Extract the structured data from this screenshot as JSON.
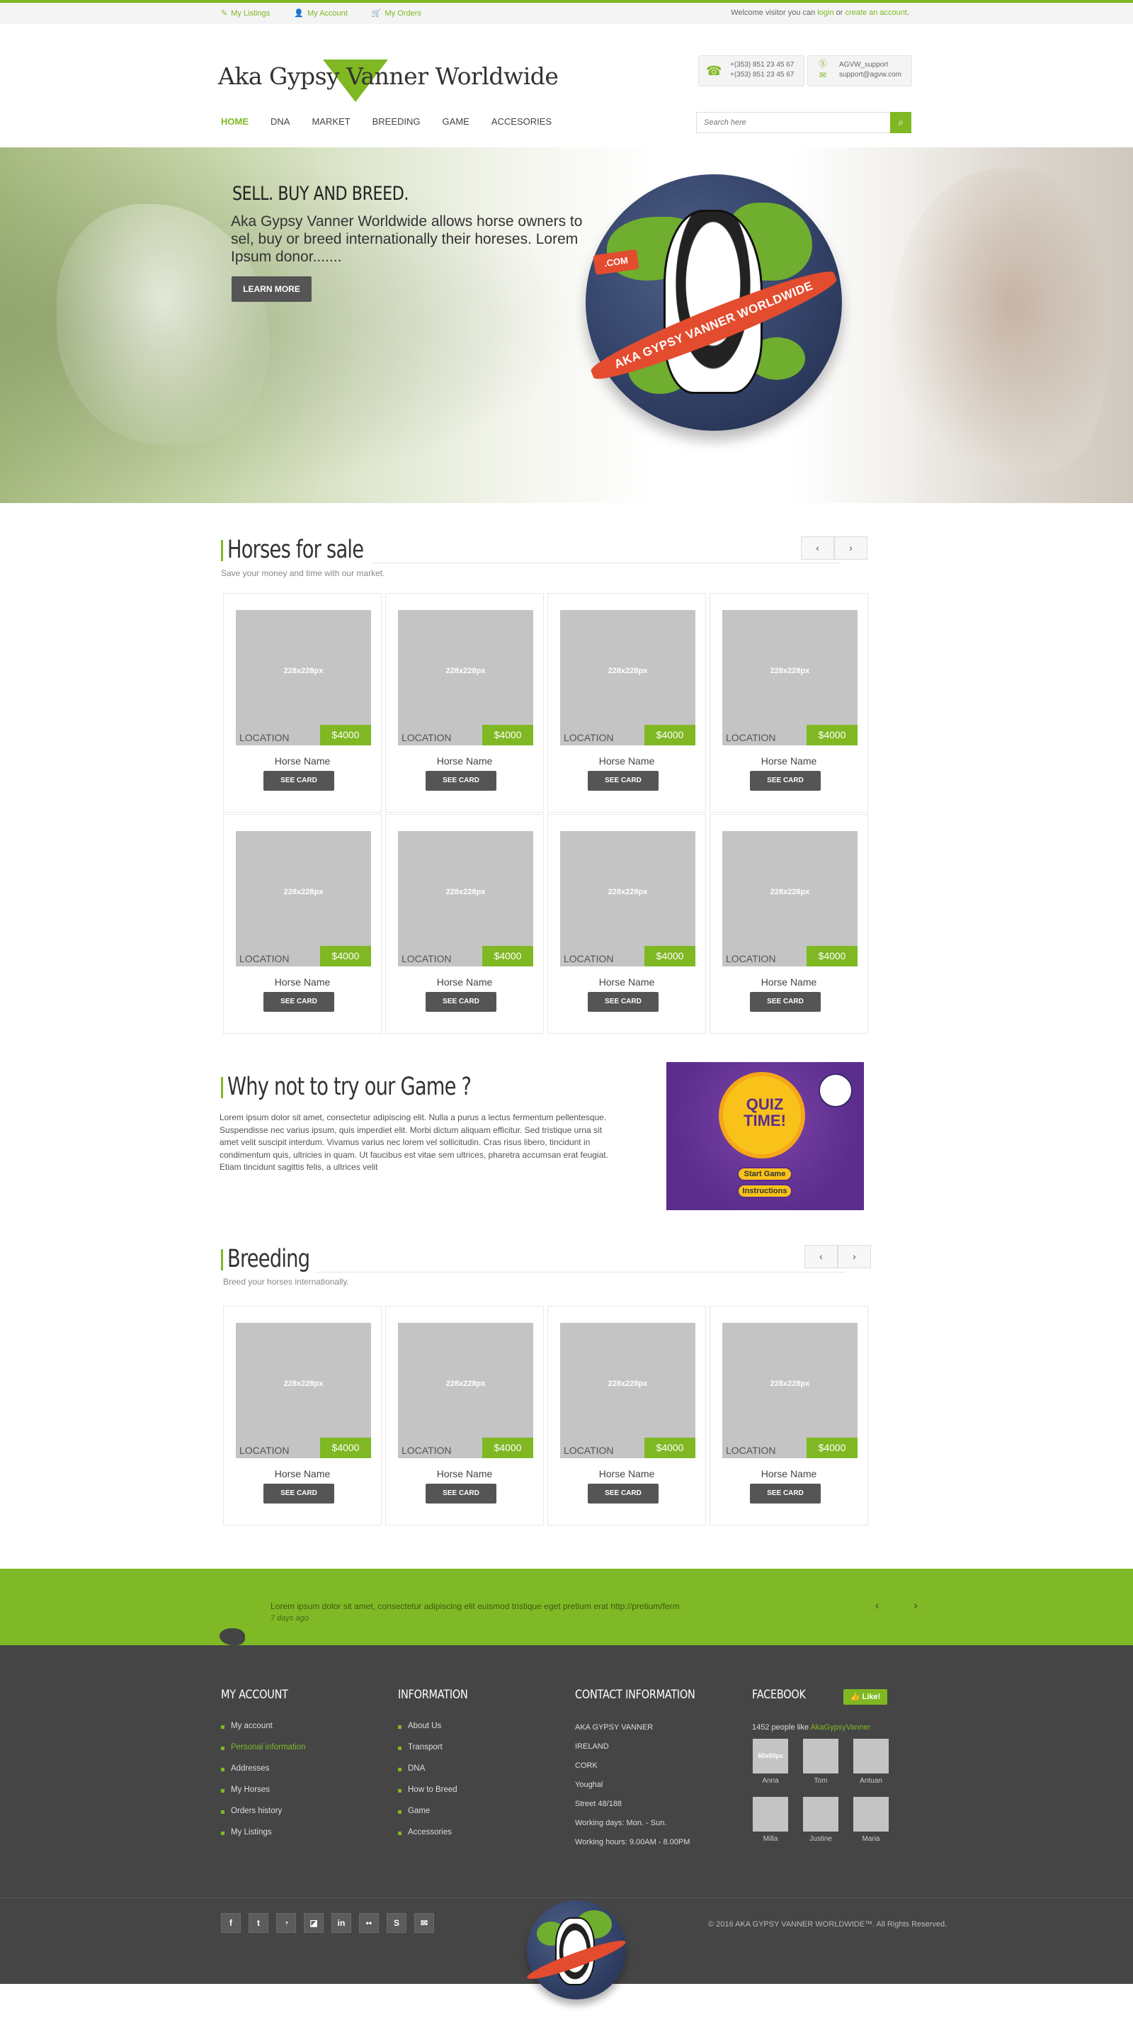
{
  "topbar": {
    "links": [
      {
        "icon": "edit-icon",
        "label": "My Listings"
      },
      {
        "icon": "user-icon",
        "label": "My Account"
      },
      {
        "icon": "cart-icon",
        "label": "My Orders"
      }
    ],
    "welcome_prefix": "Welcome visitor you can ",
    "login": "login",
    "or": " or ",
    "create_account": "create an account",
    "period": "."
  },
  "header": {
    "logo_text": "Aka Gypsy Vanner Worldwide",
    "phone_icon": "headset-icon",
    "phone1": "+(353) 851 23 45 67",
    "phone2": "+(353) 851 23 45 67",
    "skype_icon": "skype-icon",
    "mail_icon": "mail-icon",
    "skype": "AGVW_support",
    "email": "support@agvw.com"
  },
  "nav": {
    "items": [
      "HOME",
      "DNA",
      "MARKET",
      "BREEDING",
      "GAME",
      "ACCESORIES"
    ],
    "active": "HOME",
    "search_placeholder": "Search here",
    "search_icon": "search-icon"
  },
  "hero": {
    "title": "SELL. BUY AND BREED.",
    "text": "Aka Gypsy Vanner Worldwide allows horse owners to sel, buy or breed internationally their horeses. Lorem Ipsum donor.......",
    "button": "LEARN MORE",
    "globe_com": ".COM",
    "globe_ribbon": "AKA GYPSY VANNER WORLDWIDE"
  },
  "sale": {
    "title": "Horses for sale",
    "subtitle": "Save your money and time with our market.",
    "cards": [
      {
        "img": "228x228px",
        "location": "LOCATION",
        "price": "$4000",
        "name": "Horse Name",
        "button": "SEE CARD"
      },
      {
        "img": "228x228px",
        "location": "LOCATION",
        "price": "$4000",
        "name": "Horse Name",
        "button": "SEE CARD"
      },
      {
        "img": "228x228px",
        "location": "LOCATION",
        "price": "$4000",
        "name": "Horse Name",
        "button": "SEE CARD"
      },
      {
        "img": "228x228px",
        "location": "LOCATION",
        "price": "$4000",
        "name": "Horse Name",
        "button": "SEE CARD"
      },
      {
        "img": "228x228px",
        "location": "LOCATION",
        "price": "$4000",
        "name": "Horse Name",
        "button": "SEE CARD"
      },
      {
        "img": "228x228px",
        "location": "LOCATION",
        "price": "$4000",
        "name": "Horse Name",
        "button": "SEE CARD"
      },
      {
        "img": "228x228px",
        "location": "LOCATION",
        "price": "$4000",
        "name": "Horse Name",
        "button": "SEE CARD"
      },
      {
        "img": "228x228px",
        "location": "LOCATION",
        "price": "$4000",
        "name": "Horse Name",
        "button": "SEE CARD"
      }
    ]
  },
  "game": {
    "title": "Why not to try our Game ?",
    "text": "Lorem ipsum dolor sit amet, consectetur adipiscing elit. Nulla a purus a lectus fermentum pellentesque. Suspendisse nec varius ipsum, quis imperdiet elit. Morbi dictum aliquam efficitur. Sed tristique urna sit amet velit suscipit interdum. Vivamus varius nec lorem vel sollicitudin. Cras risus libero, tincidunt in condimentum quis, ultricies in quam. Ut faucibus est vitae sem ultrices, pharetra accumsan erat feugiat. Etiam tincidunt sagittis felis, a ultrices velit",
    "quiz_title": "QUIZ TIME!",
    "start": "Start Game",
    "instructions": "Instructions"
  },
  "breeding": {
    "title": "Breeding",
    "subtitle": "Breed your horses internationally.",
    "cards": [
      {
        "img": "228x228px",
        "location": "LOCATION",
        "price": "$4000",
        "name": "Horse Name",
        "button": "SEE CARD"
      },
      {
        "img": "228x228px",
        "location": "LOCATION",
        "price": "$4000",
        "name": "Horse Name",
        "button": "SEE CARD"
      },
      {
        "img": "228x228px",
        "location": "LOCATION",
        "price": "$4000",
        "name": "Horse Name",
        "button": "SEE CARD"
      },
      {
        "img": "228x228px",
        "location": "LOCATION",
        "price": "$4000",
        "name": "Horse Name",
        "button": "SEE CARD"
      }
    ]
  },
  "tweet": {
    "text": "Lorem ipsum dolor sit amet, consectetur adipiscing elit euismod tristique eget pretium erat http://pretium/ferm",
    "when": "7 days ago",
    "prev": "‹",
    "next": "›",
    "icon": "twitter-bird-icon"
  },
  "footer": {
    "account_title": "MY ACCOUNT",
    "account_items": [
      "My account",
      "Personal information",
      "Addresses",
      "My Horses",
      "Orders history",
      "My Listings"
    ],
    "info_title": "INFORMATION",
    "info_items": [
      "About Us",
      "Transport",
      "DNA",
      "How to Breed",
      "Game",
      "Accessories"
    ],
    "contact_title": "CONTACT INFORMATION",
    "contact_lines": [
      "AKA GYPSY VANNER",
      "IRELAND",
      "CORK",
      "Youghal",
      "Street 48/188",
      "Working days: Mon. - Sun.",
      "Working hours: 9.00AM - 8.00PM"
    ],
    "facebook_title": "FACEBOOK",
    "like": "Like!",
    "fb_count": "1452 people like ",
    "fb_page": "AkaGypsyVanner",
    "friends": [
      "Anna",
      "Tom",
      "Antuan",
      "Milla",
      "Justine",
      "Maria"
    ],
    "friend_first_label": "60x60px",
    "social": [
      "f",
      "t",
      "rss",
      "del",
      "in",
      "flickr",
      "S",
      "mail"
    ],
    "social_icons": [
      "facebook-icon",
      "twitter-icon",
      "rss-icon",
      "delicious-icon",
      "linkedin-icon",
      "flickr-icon",
      "skype-icon",
      "mail-icon"
    ],
    "copyright": "© 2016 AKA GYPSY VANNER WORLDWIDE™. All Rights Reserved."
  },
  "colors": {
    "accent": "#7fb823",
    "dark": "#454545",
    "button": "#555555"
  }
}
